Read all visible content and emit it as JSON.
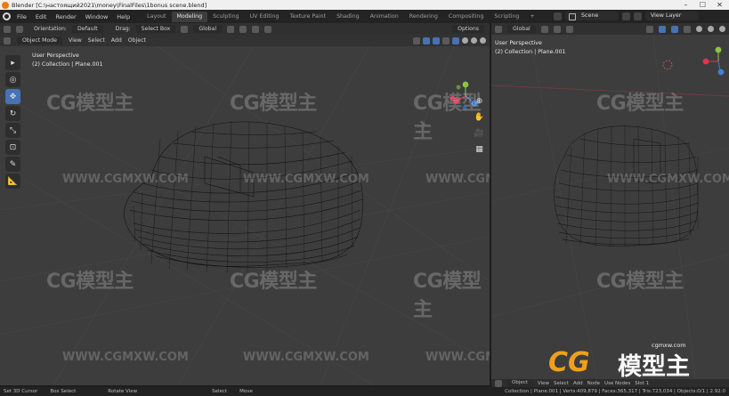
{
  "titlebar": {
    "title": "Blender [C:\\настоящий2021\\money\\FinalFiles\\1bonus scene.blend]"
  },
  "menu": {
    "items": [
      "File",
      "Edit",
      "Render",
      "Window",
      "Help"
    ]
  },
  "tabs": [
    "Layout",
    "Modeling",
    "Sculpting",
    "UV Editing",
    "Texture Paint",
    "Shading",
    "Animation",
    "Rendering",
    "Compositing",
    "Scripting",
    "+"
  ],
  "active_tab": "Modeling",
  "scene": {
    "scene_label": "Scene",
    "view_layer_label": "View Layer"
  },
  "left_header": {
    "orientation_label": "Orientation:",
    "orientation_value": "Default",
    "drag_label": "Drag:",
    "drag_value": "Select Box",
    "transform_space": "Global",
    "mode": "Object Mode",
    "view": "View",
    "select": "Select",
    "add": "Add",
    "object": "Object",
    "options": "Options"
  },
  "right_header": {
    "transform_space": "Global"
  },
  "left_overlay": {
    "perspective": "User Perspective",
    "collection": "(2) Collection | Plane.001"
  },
  "right_overlay": {
    "perspective": "User Perspective",
    "collection": "(2) Collection | Plane.001"
  },
  "watermark": {
    "brand": "CG模型主",
    "url": "WWW.CGMXW.COM",
    "corner_url": "cgmxw.com",
    "corner_cg": "CG",
    "corner_cn": "模型主"
  },
  "right_footer": {
    "object": "Object",
    "view": "View",
    "select": "Select",
    "add": "Add",
    "node": "Node",
    "use_nodes": "Use Nodes",
    "slot": "Slot 1"
  },
  "statusbar": {
    "set_cursor": "Set 3D Cursor",
    "box_select": "Box Select",
    "rotate_view": "Rotate View",
    "select": "Select",
    "move": "Move",
    "stats": "Collection | Plane.001 | Verts:409,879 | Faces:365,317 | Tris:723,034 | Objects:0/1 | 2.92.0"
  },
  "colors": {
    "accent": "#4772b3",
    "viewport": "#3d3d3d",
    "orange": "#e87d0d"
  },
  "icons": [
    "blender-logo",
    "select-box-icon",
    "cursor-icon",
    "move-icon",
    "rotate-icon",
    "scale-icon",
    "transform-icon",
    "annotate-icon",
    "measure-icon",
    "zoom-icon",
    "hand-icon",
    "camera-icon",
    "grid-icon"
  ]
}
